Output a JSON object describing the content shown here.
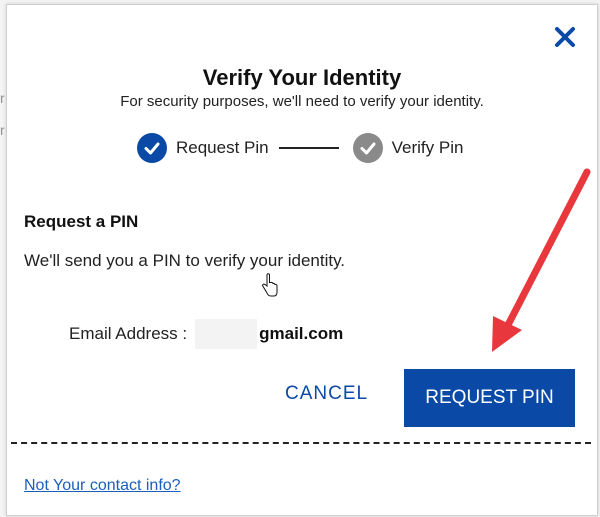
{
  "dialog": {
    "title": "Verify Your Identity",
    "subtitle": "For security purposes, we'll need to verify your identity.",
    "close_icon": "close-icon"
  },
  "steps": [
    {
      "label": "Request Pin",
      "state": "active",
      "icon": "check-circle-icon"
    },
    {
      "label": "Verify Pin",
      "state": "pending",
      "icon": "check-circle-icon"
    }
  ],
  "section": {
    "title": "Request a PIN",
    "body": "We'll send you a PIN to verify your identity."
  },
  "email": {
    "label": "Email Address :",
    "domain": "gmail.com"
  },
  "actions": {
    "cancel_label": "CANCEL",
    "request_label": "REQUEST PIN"
  },
  "footer": {
    "link_label": "Not Your contact info?"
  },
  "colors": {
    "primary": "#0a4aa6",
    "step_pending": "#8a8a8a",
    "annotation_arrow": "#e8383d",
    "link": "#1a5fbf"
  }
}
